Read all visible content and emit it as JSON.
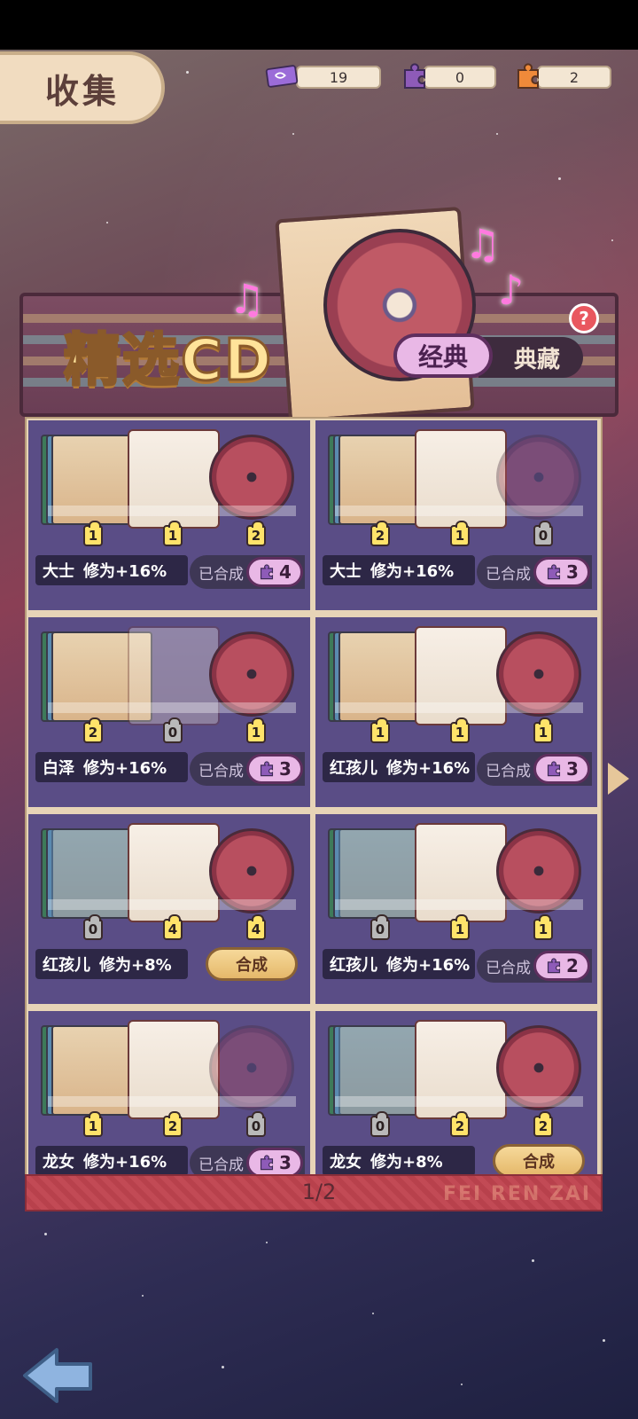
{
  "header": {
    "title": "收集",
    "resources": [
      {
        "icon": "ticket-icon",
        "value": "19",
        "color": "#9b6cd8"
      },
      {
        "icon": "purple-puzzle-icon",
        "value": "0",
        "color": "#8e5bb8"
      },
      {
        "icon": "orange-puzzle-icon",
        "value": "2",
        "color": "#f08a3a"
      }
    ]
  },
  "banner": {
    "title": "精选CD",
    "tabs": {
      "classic": "经典",
      "collection": "典藏"
    },
    "help_label": "?"
  },
  "cards": [
    {
      "name": "大士",
      "bonus": "修为+16%",
      "counts": [
        "1",
        "1",
        "2"
      ],
      "status": "已合成",
      "pieces": "4",
      "synthesized": true,
      "faded": ""
    },
    {
      "name": "大士",
      "bonus": "修为+16%",
      "counts": [
        "2",
        "1",
        "0"
      ],
      "status": "已合成",
      "pieces": "3",
      "synthesized": true,
      "faded": "right"
    },
    {
      "name": "白泽",
      "bonus": "修为+16%",
      "counts": [
        "2",
        "0",
        "1"
      ],
      "status": "已合成",
      "pieces": "3",
      "synthesized": true,
      "faded": "middle"
    },
    {
      "name": "红孩儿",
      "bonus": "修为+16%",
      "counts": [
        "1",
        "1",
        "1"
      ],
      "status": "已合成",
      "pieces": "3",
      "synthesized": true,
      "faded": ""
    },
    {
      "name": "红孩儿",
      "bonus": "修为+8%",
      "counts": [
        "0",
        "4",
        "4"
      ],
      "action": "合成",
      "synthesized": false,
      "faded": "left"
    },
    {
      "name": "红孩儿",
      "bonus": "修为+16%",
      "counts": [
        "0",
        "1",
        "1"
      ],
      "status": "已合成",
      "pieces": "2",
      "synthesized": true,
      "faded": "left"
    },
    {
      "name": "龙女",
      "bonus": "修为+16%",
      "counts": [
        "1",
        "2",
        "0"
      ],
      "status": "已合成",
      "pieces": "3",
      "synthesized": true,
      "faded": "right"
    },
    {
      "name": "龙女",
      "bonus": "修为+8%",
      "counts": [
        "0",
        "2",
        "2"
      ],
      "action": "合成",
      "synthesized": false,
      "faded": "left"
    }
  ],
  "pagination": {
    "label": "1/2"
  },
  "watermark": "FEI REN ZAI",
  "nav": {
    "back_icon": "back-arrow-icon",
    "next_icon": "next-page-arrow-icon"
  }
}
